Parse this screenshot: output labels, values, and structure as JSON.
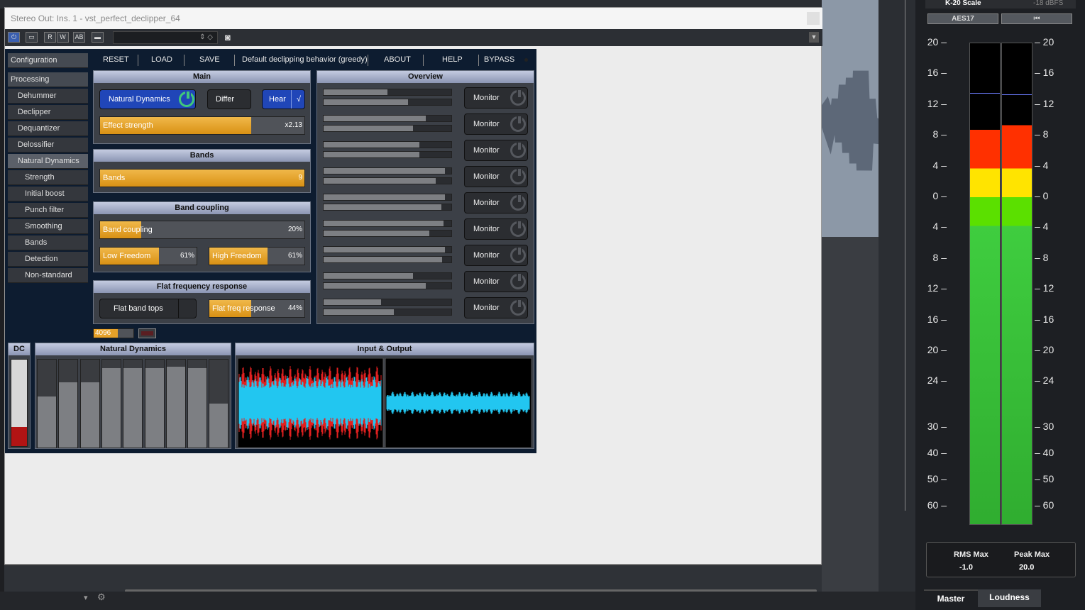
{
  "window": {
    "title": "Stereo Out: Ins. 1 - vst_perfect_declipper_64"
  },
  "sidebar": {
    "items": [
      {
        "label": "Configuration",
        "level": 0
      },
      {
        "label": "Processing",
        "level": 0
      },
      {
        "label": "Dehummer",
        "level": 1
      },
      {
        "label": "Declipper",
        "level": 1
      },
      {
        "label": "Dequantizer",
        "level": 1
      },
      {
        "label": "Delossifier",
        "level": 1
      },
      {
        "label": "Natural Dynamics",
        "level": 1,
        "active": true
      },
      {
        "label": "Strength",
        "level": 2
      },
      {
        "label": "Initial boost",
        "level": 2
      },
      {
        "label": "Punch filter",
        "level": 2
      },
      {
        "label": "Smoothing",
        "level": 2
      },
      {
        "label": "Bands",
        "level": 2
      },
      {
        "label": "Detection",
        "level": 2
      },
      {
        "label": "Non-standard",
        "level": 2
      }
    ]
  },
  "toolbar": {
    "reset": "RESET",
    "load": "LOAD",
    "save": "SAVE",
    "preset": "Default declipping behavior (greedy)",
    "about": "ABOUT",
    "help": "HELP",
    "bypass": "BYPASS"
  },
  "main": {
    "title": "Main",
    "natural_dynamics": "Natural Dynamics",
    "differ": "Differ",
    "hear": "Hear",
    "hear_check": "√",
    "effect_strength": {
      "label": "Effect strength",
      "value": "x2.13",
      "fill": 0.74
    }
  },
  "bands": {
    "title": "Bands",
    "bands_slider": {
      "label": "Bands",
      "value": "9",
      "fill": 1.0
    }
  },
  "band_coupling": {
    "title": "Band coupling",
    "coupling": {
      "label": "Band coupling",
      "value": "20%",
      "fill": 0.2
    },
    "low_freedom": {
      "label": "Low Freedom",
      "value": "61%",
      "fill": 0.61
    },
    "high_freedom": {
      "label": "High Freedom",
      "value": "61%",
      "fill": 0.61
    }
  },
  "flat": {
    "title": "Flat frequency response",
    "flat_band_tops": "Flat band tops",
    "flat_freq": {
      "label": "Flat freq response",
      "value": "44%",
      "fill": 0.44
    }
  },
  "overview": {
    "title": "Overview",
    "monitor_label": "Monitor",
    "rows": [
      [
        0.5,
        0.66
      ],
      [
        0.8,
        0.7
      ],
      [
        0.75,
        0.75
      ],
      [
        0.95,
        0.88
      ],
      [
        0.95,
        0.92
      ],
      [
        0.94,
        0.83
      ],
      [
        0.95,
        0.93
      ],
      [
        0.7,
        0.8
      ],
      [
        0.45,
        0.55
      ]
    ]
  },
  "buffer": {
    "value": "4096",
    "fill": 0.6
  },
  "bottom": {
    "dc_title": "DC",
    "dc_level": 0.22,
    "nd_title": "Natural Dynamics",
    "nd_levels": [
      0.58,
      0.74,
      0.74,
      0.9,
      0.9,
      0.9,
      0.92,
      0.9,
      0.5
    ],
    "io_title": "Input & Output"
  },
  "meter": {
    "scale": "K-20 Scale",
    "dbfs": "-18 dBFS",
    "aes": "AES17",
    "skip": "⏮",
    "ticks": [
      "20",
      "16",
      "12",
      "8",
      "4",
      "0",
      "4",
      "8",
      "12",
      "16",
      "20",
      "24",
      "30",
      "40",
      "50",
      "60"
    ],
    "rms_label": "RMS Max",
    "rms_value": "-1.0",
    "peak_label": "Peak Max",
    "peak_value": "20.0",
    "tab_master": "Master",
    "tab_loudness": "Loudness"
  },
  "colors": {
    "accent_orange": "#e6a129",
    "toggle_blue": "#2046b8",
    "plugin_bg": "#0d1c30",
    "waveform_in": "#22c6f0",
    "waveform_clip": "#e02020"
  }
}
